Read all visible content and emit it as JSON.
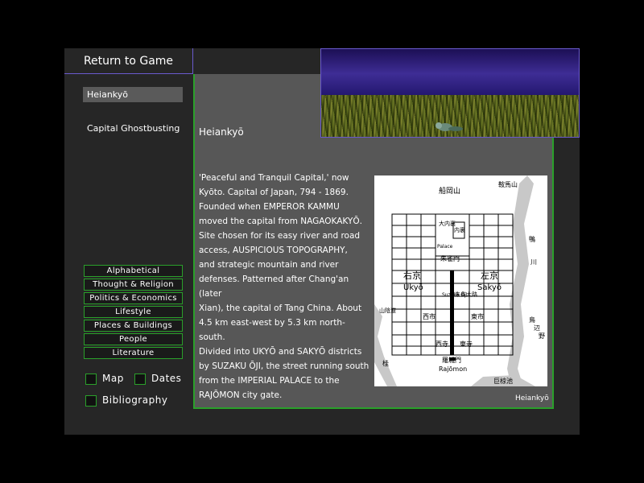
{
  "nav": {
    "return_label": "Return to Game"
  },
  "sidebar": {
    "entry_selected": "Heiankyō",
    "entry_link": "Capital Ghostbusting",
    "categories": [
      "Alphabetical",
      "Thought & Religion",
      "Politics & Economics",
      "Lifestyle",
      "Places & Buildings",
      "People",
      "Literature"
    ],
    "options": {
      "map": "Map",
      "dates": "Dates",
      "bibliography": "Bibliography"
    }
  },
  "article": {
    "title": "Heiankyō",
    "lines": [
      "'Peaceful and Tranquil Capital,' now",
      "Kyōto. Capital of Japan, 794 - 1869.",
      "Founded when EMPEROR KAMMU",
      "moved the capital from NAGAOKAKYŌ.",
      "Site chosen for its easy river and road",
      "access, AUSPICIOUS TOPOGRAPHY,",
      "and strategic mountain and river",
      "defenses. Patterned after Chang'an (later",
      "Xian), the capital of Tang China. About",
      "4.5 km east-west by 5.3 km north-south.",
      "Divided into UKYŌ and SAKYŌ districts",
      "by SUZAKU ŌJI, the street running south",
      "from the IMPERIAL PALACE to the",
      "RAJŌMON city gate."
    ],
    "caption": "Heiankyō"
  },
  "map": {
    "funaokayama": "船岡山",
    "kuramayama": "鞍馬山",
    "kamo": "鴨",
    "kawa": "川",
    "dairi": "内裏",
    "daidairi": "大内裏",
    "palace": "Palace",
    "suzakumon": "朱雀門",
    "ukyo_jp": "右京",
    "ukyo": "Ukyō",
    "sakyo_jp": "左京",
    "sakyo": "Sakyō",
    "suzaku_jp": "朱雀大路",
    "suzaku": "Suzaku Ōji",
    "nishi_ichi": "西市",
    "higashi_ichi": "東市",
    "nishi_dera": "西寺",
    "higashi_dera": "東寺",
    "rajomon_jp": "羅城門",
    "rajomon": "Rajōmon",
    "sanindo": "山陰道",
    "katsura": "桂",
    "toba": "鳥",
    "be": "辺",
    "no": "野",
    "ogura": "巨椋池"
  }
}
